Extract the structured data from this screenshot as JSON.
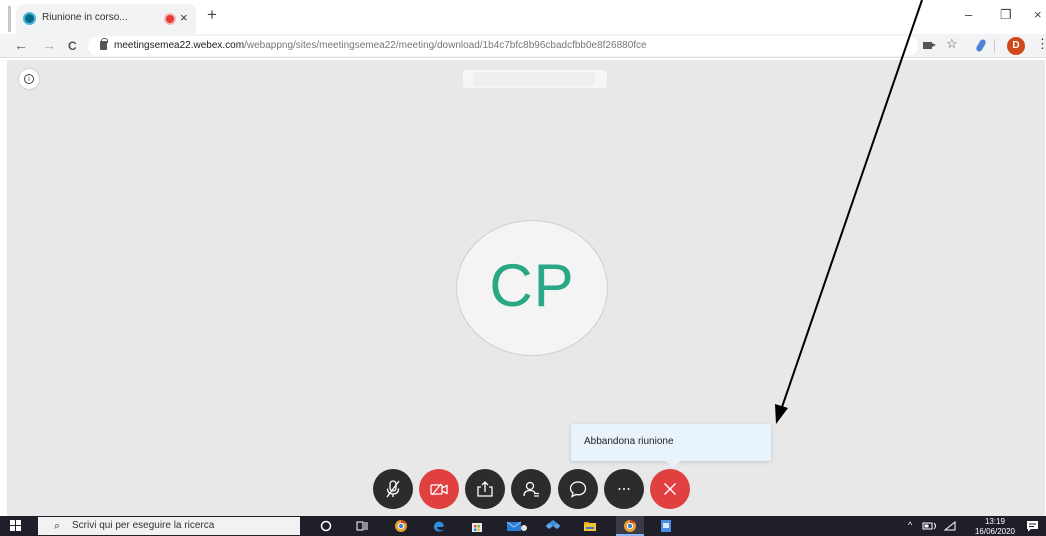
{
  "browser": {
    "tab_title": "Riunione in corso...",
    "tab_close": "×",
    "new_tab": "+",
    "url_host": "meetingsemea22.webex.com",
    "url_path": "/webappng/sites/meetingsemea22/meeting/download/1b4c7bfc8b96cbadcfbb0e8f26880fce",
    "nav_back": "←",
    "nav_forward": "→",
    "nav_reload": "C",
    "window_minimize": "–",
    "window_restore": "❐",
    "window_close": "×",
    "star": "☆",
    "menu": "⋮",
    "profile_initial": "D"
  },
  "meeting": {
    "info_glyph": "i",
    "participant_initials": "CP",
    "tooltip_text": "Abbandona riunione",
    "initials_color": "#2aa784",
    "controls": [
      {
        "name": "mute-microphone",
        "icon": "microphone-off-icon"
      },
      {
        "name": "stop-video",
        "icon": "video-off-icon"
      },
      {
        "name": "share-content",
        "icon": "share-icon"
      },
      {
        "name": "participants",
        "icon": "participants-icon"
      },
      {
        "name": "chat",
        "icon": "chat-icon"
      },
      {
        "name": "more-options",
        "icon": "more-icon"
      },
      {
        "name": "leave-meeting",
        "icon": "close-icon"
      }
    ],
    "leave_color": "#e04040",
    "video_off_color": "#e04040"
  },
  "taskbar": {
    "search_placeholder": "Scrivi qui per eseguire la ricerca",
    "search_glyph": "⌕",
    "time": "13:19",
    "date": "16/06/2020"
  }
}
